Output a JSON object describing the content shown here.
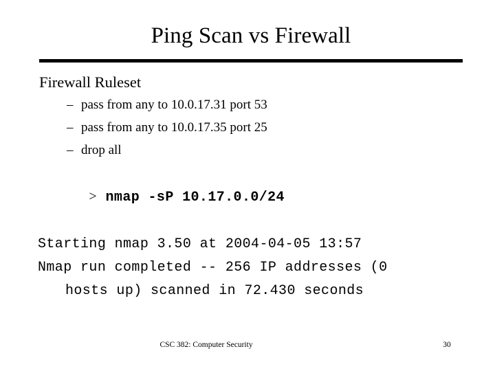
{
  "slide": {
    "title": "Ping Scan vs Firewall",
    "heading": "Firewall Ruleset",
    "bullet_marker": "–",
    "rules": [
      "pass from any to 10.0.17.31 port 53",
      "pass from any to 10.0.17.35 port 25",
      "drop all"
    ],
    "terminal": {
      "prompt": ">",
      "command": "nmap -sP 10.17.0.0/24",
      "output_line_1": "Starting nmap 3.50 at 2004-04-05 13:57",
      "output_line_2": "Nmap run completed -- 256 IP addresses (0",
      "output_line_2_wrap": "hosts up) scanned in 72.430 seconds"
    },
    "footer": {
      "course": "CSC 382: Computer Security",
      "page_number": "30"
    },
    "colors": {
      "text": "#000000",
      "background": "#ffffff",
      "rule": "#000000"
    }
  }
}
